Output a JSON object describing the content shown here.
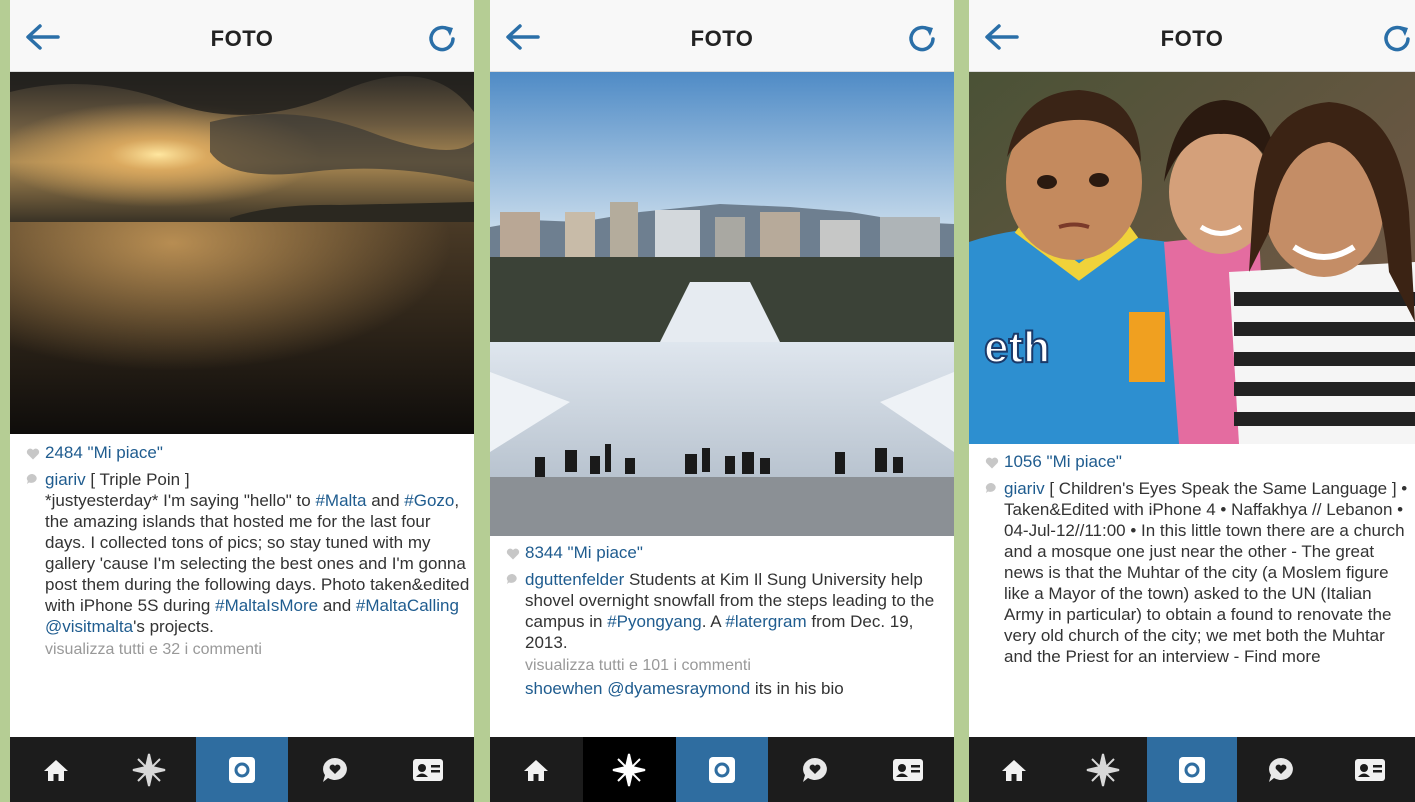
{
  "colors": {
    "background": "#b5cd94",
    "link": "#1f5c8f",
    "tabbar": "#1c1c1c",
    "camera_tab": "#2f6da0",
    "nav_icon": "#2a6fa8"
  },
  "icons": {
    "back": "arrow-left-icon",
    "refresh": "refresh-icon",
    "like": "heart-icon",
    "comment": "comment-bubble-icon",
    "tabs": [
      "home-icon",
      "explore-star-icon",
      "camera-icon",
      "activity-heart-bubble-icon",
      "profile-card-icon"
    ]
  },
  "phones": [
    {
      "nav_title": "FOTO",
      "likes": "2484 \"Mi piace\"",
      "caption": {
        "username": "giariv",
        "parts": [
          {
            "t": " [ Triple Poin ]\n*justyesterday* I'm saying \"hello\" to "
          },
          {
            "t": "#Malta",
            "tag": true
          },
          {
            "t": " and "
          },
          {
            "t": "#Gozo",
            "tag": true
          },
          {
            "t": ", the amazing islands that hosted me for the last four days. I collected tons of pics; so stay tuned with my gallery 'cause I'm selecting the best ones and I'm gonna post them during the following days. Photo taken&edited with iPhone 5S during "
          },
          {
            "t": "#MaltaIsMore",
            "tag": true
          },
          {
            "t": " and "
          },
          {
            "t": "#MaltaCalling",
            "tag": true
          },
          {
            "t": " "
          },
          {
            "t": "@visitmalta",
            "tag": true
          },
          {
            "t": "'s projects."
          }
        ]
      },
      "comments_link": "visualizza tutti e 32 i commenti",
      "active_tab": 2
    },
    {
      "nav_title": "FOTO",
      "likes": "8344 \"Mi piace\"",
      "caption": {
        "username": "dguttenfelder",
        "parts": [
          {
            "t": " Students at Kim Il Sung University help shovel overnight snowfall from the steps leading to the campus in "
          },
          {
            "t": "#Pyongyang",
            "tag": true
          },
          {
            "t": ". A "
          },
          {
            "t": "#latergram",
            "tag": true
          },
          {
            "t": " from Dec. 19, 2013."
          }
        ]
      },
      "comments_link": "visualizza tutti e 101 i commenti",
      "comment": {
        "username": "shoewhen",
        "mention": "@dyamesraymond",
        "text": " its in his bio"
      },
      "active_tab": 1
    },
    {
      "nav_title": "FOTO",
      "likes": "1056 \"Mi piace\"",
      "caption": {
        "username": "giariv",
        "parts": [
          {
            "t": " [ Children's Eyes Speak the Same Language ] • Taken&Edited with iPhone 4 • Naffakhya // Lebanon • 04-Jul-12//11:00 • In this little town there are a church and a mosque one just near the other - The great news is that the Muhtar of the city (a Moslem figure like a Mayor of the town) asked to the UN (Italian Army in particular) to obtain a found to renovate the very old church of the city; we met both the Muhtar and the Priest for an interview - Find more"
          }
        ]
      },
      "active_tab": 2
    }
  ]
}
